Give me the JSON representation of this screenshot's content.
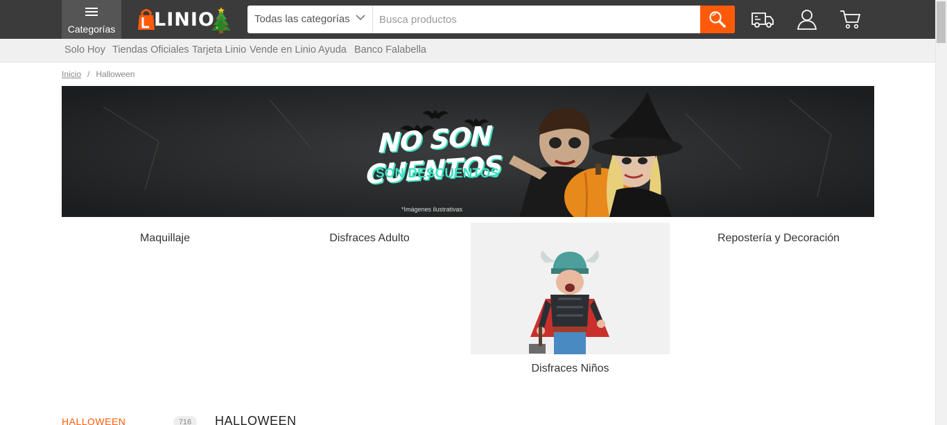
{
  "header": {
    "categories_label": "Categorías",
    "logo_text": "LINIO",
    "search": {
      "category_selected": "Todas las categorías",
      "placeholder": "Busca productos"
    },
    "colors": {
      "accent": "#ff5a0a",
      "bar": "#3b3b3b"
    }
  },
  "subnav": [
    "Solo Hoy",
    "Tiendas Oficiales",
    "Tarjeta Linio",
    "Vende en Linio",
    "Ayuda",
    "Banco Falabella"
  ],
  "breadcrumb": {
    "home": "Inicio",
    "current": "Halloween"
  },
  "banner": {
    "headline": "NO SON CUENTOS",
    "subheadline": "SON DESCUENTOS",
    "note": "*Imágenes ilustrativas"
  },
  "categories": [
    "Maquillaje",
    "Disfraces Adulto",
    "Disfraces Niños",
    "Repostería y Decoración"
  ],
  "sidebar": {
    "label": "HALLOWEEN",
    "count": "716"
  },
  "main": {
    "title": "HALLOWEEN"
  }
}
